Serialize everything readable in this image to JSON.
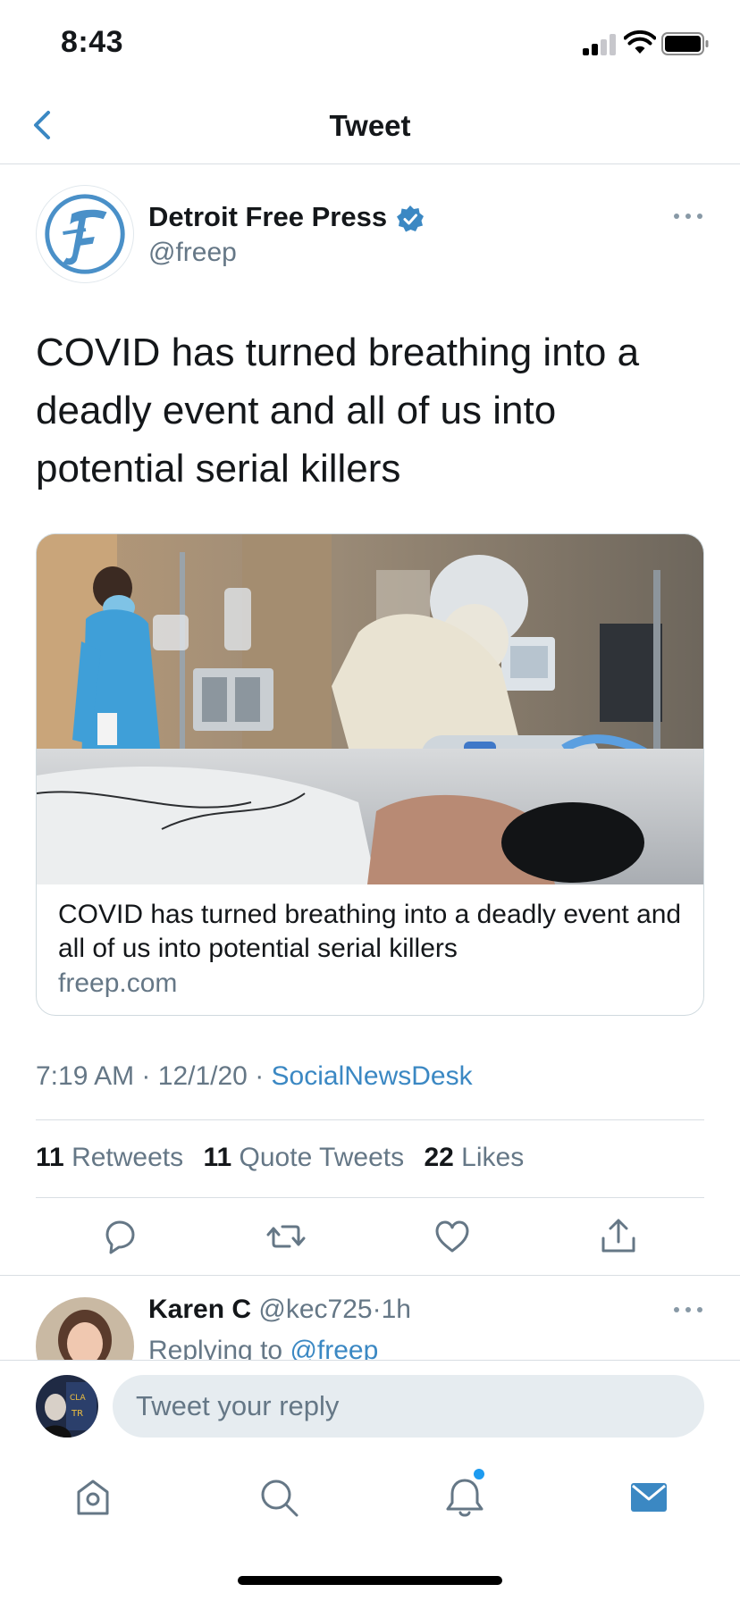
{
  "status_bar": {
    "time": "8:43"
  },
  "nav": {
    "title": "Tweet"
  },
  "tweet": {
    "author_name": "Detroit Free Press",
    "author_handle": "@freep",
    "text": "COVID has turned breathing into a deadly event and all of us into potential serial killers",
    "card": {
      "title": "COVID has turned breathing into a deadly event and all of us into potential serial killers",
      "domain": "freep.com"
    },
    "time": "7:19 AM",
    "date": "12/1/20",
    "separator": "·",
    "source": "SocialNewsDesk",
    "stats": {
      "retweets_count": "11",
      "retweets_label": "Retweets",
      "quotes_count": "11",
      "quotes_label": "Quote Tweets",
      "likes_count": "22",
      "likes_label": "Likes"
    }
  },
  "reply": {
    "name": "Karen C",
    "handle": "@kec725",
    "separator": "·",
    "age": "1h",
    "replying_to_label": "Replying to",
    "replying_to_mention": "@freep"
  },
  "compose": {
    "placeholder": "Tweet your reply"
  },
  "icons": {
    "back": "chevron-left-icon",
    "verified": "verified-badge-icon",
    "more": "more-horizontal-icon",
    "reply": "comment-icon",
    "retweet": "retweet-icon",
    "like": "heart-icon",
    "share": "share-icon",
    "home": "home-icon",
    "search": "search-icon",
    "notifications": "bell-icon",
    "messages": "mail-icon"
  },
  "colors": {
    "accent": "#3b88c3",
    "text": "#14171a",
    "secondary_text": "#657786",
    "divider": "#d9dee3",
    "input_bg": "#e6ecf0"
  }
}
